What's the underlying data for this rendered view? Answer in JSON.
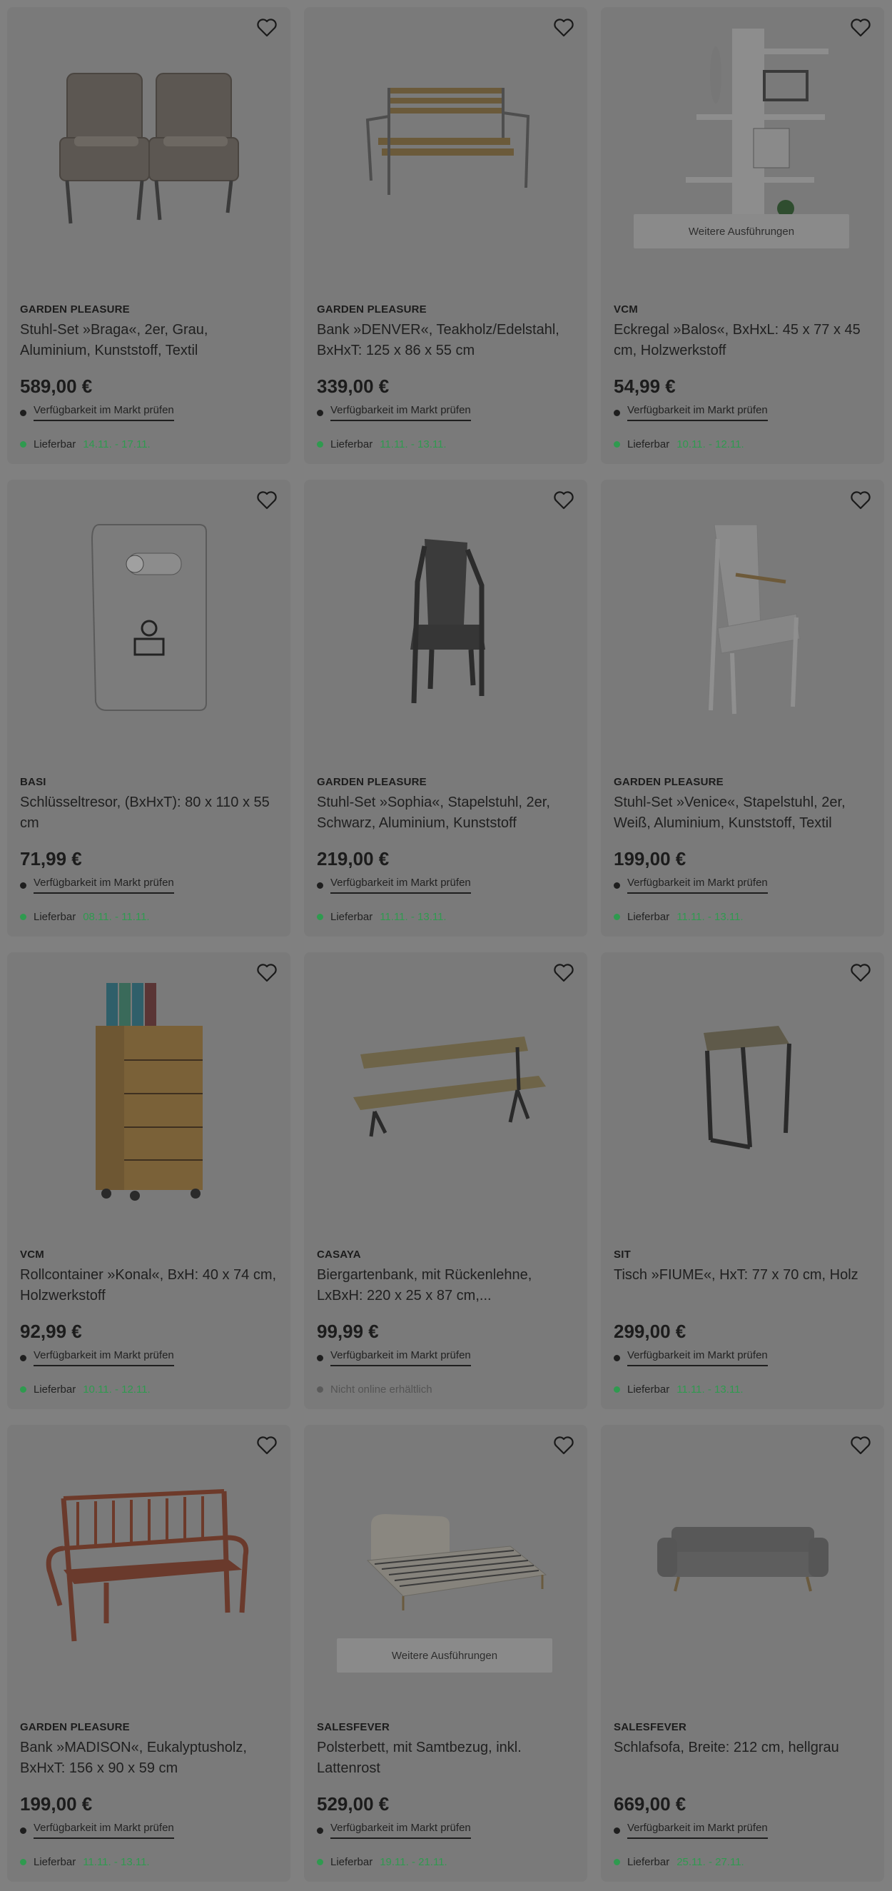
{
  "wishlist_icon": "heart-outline-icon",
  "avail_label": "Verfügbarkeit im Markt prüfen",
  "delivery_label": "Lieferbar",
  "variants_label": "Weitere Ausführungen",
  "not_online_label": "Nicht online erhältlich",
  "colors": {
    "overlay": "#808080",
    "delivery_green": "#2f9a4f"
  },
  "products": [
    {
      "brand": "GARDEN PLEASURE",
      "title": "Stuhl-Set »Braga«, 2er, Grau, Aluminium, Kunststoff, Textil",
      "price": "589,00 €",
      "dates": "14.11. - 17.11.",
      "image": "two-wicker-chairs"
    },
    {
      "brand": "GARDEN PLEASURE",
      "title": "Bank »DENVER«, Teakholz/Edelstahl, BxHxT: 125 x 86 x 55 cm",
      "price": "339,00 €",
      "dates": "11.11. - 13.11.",
      "image": "teak-bench"
    },
    {
      "brand": "VCM",
      "title": "Eckregal »Balos«, BxHxL: 45 x 77 x 45 cm, Holzwerkstoff",
      "price": "54,99 €",
      "dates": "10.11. - 12.11.",
      "image": "corner-shelf",
      "has_variants": true
    },
    {
      "brand": "BASI",
      "title": "Schlüsseltresor, (BxHxT): 80 x 110 x 55 cm",
      "price": "71,99 €",
      "dates": "08.11. - 11.11.",
      "image": "key-safe"
    },
    {
      "brand": "GARDEN PLEASURE",
      "title": "Stuhl-Set »Sophia«, Stapelstuhl, 2er, Schwarz, Aluminium, Kunststoff",
      "price": "219,00 €",
      "dates": "11.11. - 13.11.",
      "image": "black-stacking-chair"
    },
    {
      "brand": "GARDEN PLEASURE",
      "title": "Stuhl-Set »Venice«, Stapelstuhl, 2er, Weiß, Aluminium, Kunststoff, Textil",
      "price": "199,00 €",
      "dates": "11.11. - 13.11.",
      "image": "white-stacking-chair"
    },
    {
      "brand": "VCM",
      "title": "Rollcontainer »Konal«, BxH: 40 x 74 cm, Holzwerkstoff",
      "price": "92,99 €",
      "dates": "10.11. - 12.11.",
      "image": "drawer-container"
    },
    {
      "brand": "CASAYA",
      "title": "Biergartenbank, mit Rückenlehne, LxBxH: 220 x 25 x 87 cm,...",
      "price": "99,99 €",
      "dates": "",
      "not_online": true,
      "image": "beer-garden-bench"
    },
    {
      "brand": "SIT",
      "title": "Tisch »FIUME«, HxT: 77 x 70 cm, Holz",
      "price": "299,00 €",
      "dates": "11.11. - 13.11.",
      "image": "side-table"
    },
    {
      "brand": "GARDEN PLEASURE",
      "title": "Bank »MADISON«, Eukalyptusholz, BxHxT: 156 x 90 x 59 cm",
      "price": "199,00 €",
      "dates": "11.11. - 13.11.",
      "image": "wooden-garden-bench"
    },
    {
      "brand": "SALESFEVER",
      "title": "Polsterbett, mit Samtbezug, inkl. Lattenrost",
      "price": "529,00 €",
      "dates": "19.11. - 21.11.",
      "image": "upholstered-bed",
      "has_variants": true
    },
    {
      "brand": "SALESFEVER",
      "title": "Schlafsofa, Breite: 212 cm, hellgrau",
      "price": "669,00 €",
      "dates": "25.11. - 27.11.",
      "image": "sofa-bed"
    }
  ]
}
